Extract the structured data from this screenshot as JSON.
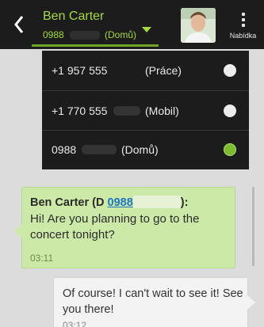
{
  "header": {
    "contact_name": "Ben Carter",
    "contact_number": "0988",
    "contact_label": "(Domů)",
    "menu_label": "Nabídka"
  },
  "number_dropdown": {
    "options": [
      {
        "number": "+1 957 555",
        "label": "(Práce)",
        "selected": false
      },
      {
        "number": "+1 770 555",
        "label": "(Mobil)",
        "selected": false
      },
      {
        "number": "0988",
        "label": "(Domů)",
        "selected": true
      }
    ]
  },
  "messages": [
    {
      "sender_prefix": "Ben Carter (D",
      "sender_link": "0988",
      "sender_suffix": "):",
      "text": "Hi! Are you planning to go to the concert tonight?",
      "time": "03:11"
    },
    {
      "text": "Of course! I can't wait to see it! See you there!",
      "time": "03:12"
    }
  ],
  "colors": {
    "accent": "#a6d93f",
    "incoming_bubble": "#cde9a8",
    "outgoing_bubble": "#f3f3f3",
    "bar_background": "#1c1c1c"
  },
  "icons": [
    "back-chevron-icon",
    "dropdown-arrow-icon",
    "menu-dots-icon"
  ]
}
